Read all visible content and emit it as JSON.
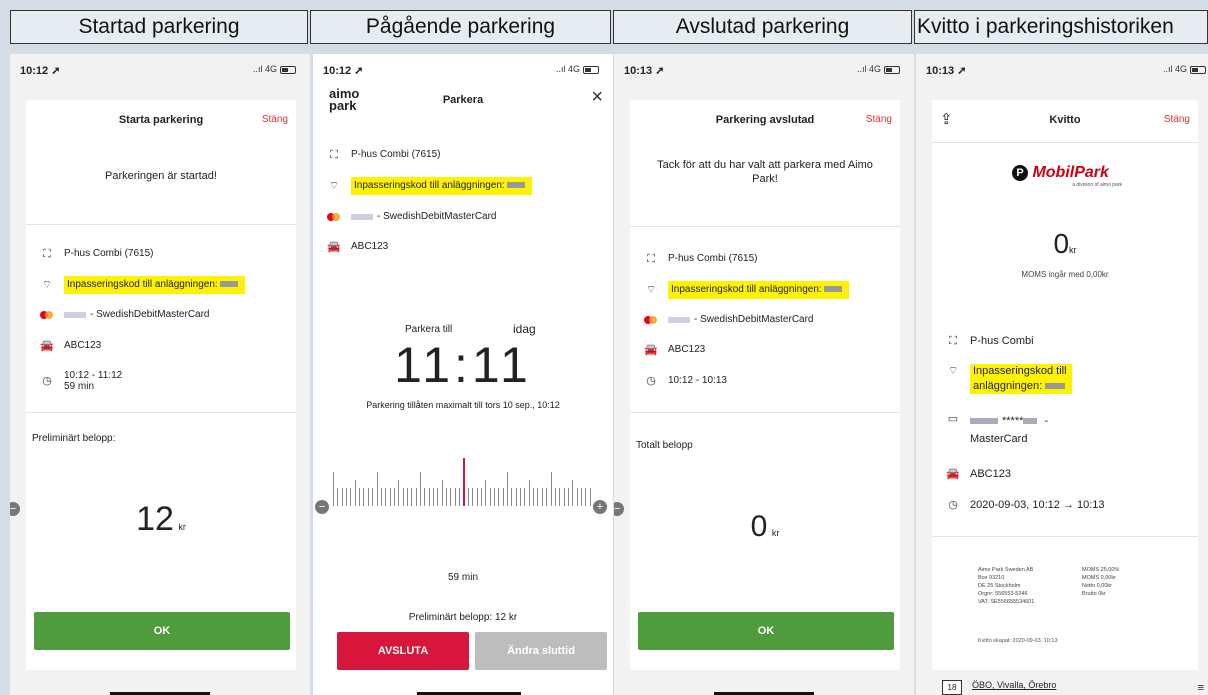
{
  "headers": [
    "Startad parkering",
    "Pågående parkering",
    "Avslutad parkering",
    "Kvitto i parkeringshistoriken"
  ],
  "p1": {
    "time": "10:12 ➚",
    "signal": "..ıl 4G",
    "title": "Starta parkering",
    "close": "Stäng",
    "message": "Parkeringen är startad!",
    "location": "P-hus Combi (7615)",
    "code": "Inpasseringskod till anläggningen:",
    "card": "- SwedishDebitMasterCard",
    "plate": "ABC123",
    "timerange": "10:12 - 11:12",
    "duration": "59 min",
    "amount_label": "Preliminärt belopp:",
    "amount": "12",
    "currency": "kr",
    "ok": "OK"
  },
  "p2": {
    "time": "10:12 ➚",
    "signal": "..ıl 4G",
    "logo_top": "aimo",
    "logo_bottom": "park",
    "title": "Parkera",
    "location": "P-hus Combi (7615)",
    "code": "Inpasseringskod till anläggningen:",
    "card": "- SwedishDebitMasterCard",
    "plate": "ABC123",
    "until_label": "Parkera till",
    "day": "idag",
    "big_time": "11:11",
    "max_note": "Parkering tillåten maximalt till tors 10 sep., 10:12",
    "duration": "59 min",
    "prelim": "Preliminärt belopp: 12 kr",
    "end": "AVSLUTA",
    "change": "Ändra sluttid"
  },
  "p3": {
    "time": "10:13 ➚",
    "signal": "..ıl 4G",
    "title": "Parkering avslutad",
    "close": "Stäng",
    "message": "Tack för att du har valt att parkera med Aimo Park!",
    "location": "P-hus Combi (7615)",
    "code": "Inpasseringskod till anläggningen:",
    "card": "- SwedishDebitMasterCard",
    "plate": "ABC123",
    "timerange": "10:12 - 10:13",
    "total_label": "Totalt belopp",
    "amount": "0",
    "currency": "kr",
    "ok": "OK"
  },
  "p4": {
    "time": "10:13 ➚",
    "signal": "..ıl 4G",
    "title": "Kvitto",
    "close": "Stäng",
    "brand": "MobilPark",
    "brand_sub": "a division of aimo park",
    "amount": "0",
    "currency": "kr",
    "vat": "MOMS ingår med 0,00kr",
    "location": "P-hus Combi",
    "code1": "Inpasseringskod till",
    "code2": "anläggningen:",
    "card_mask": "*****",
    "card": "MasterCard",
    "plate": "ABC123",
    "datetime": "2020-09-03, 10:12 → 10:13",
    "fine_left": [
      "Aimo Park Sweden AB",
      "Box 93210",
      "DE 25 Stockholm",
      "Orgnr: 556553-5346",
      "VAT: SE556655534601"
    ],
    "fine_right": [
      "MOMS 25,00%",
      "MOMS 0,00kr",
      "Netto 0,00kr",
      "Brutto 0kr"
    ],
    "created": "Kvitto skapat: 2020-09-03, 10:13",
    "cal_day": "18",
    "next_title": "ÖBO, Vivalla, Örebro"
  }
}
